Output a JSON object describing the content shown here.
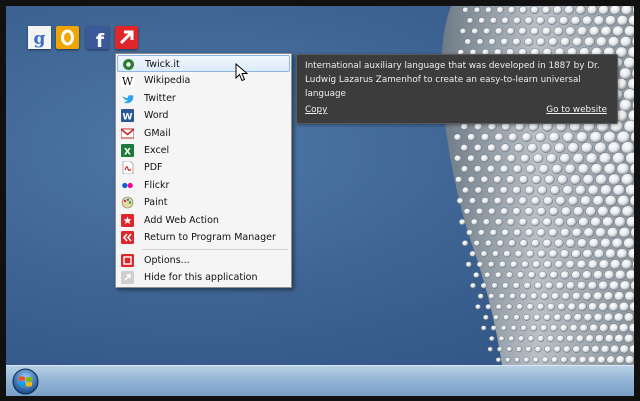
{
  "top_icons": [
    {
      "icon": "google-icon",
      "glyph": "g",
      "color": "#3a6fc9"
    },
    {
      "icon": "orange-o-icon",
      "glyph": "O",
      "color": "#f0a500"
    },
    {
      "icon": "facebook-icon",
      "glyph": "f",
      "color": "#3b5998"
    },
    {
      "icon": "twickit-arrow-icon",
      "glyph": "↗",
      "color": "#e0262a"
    }
  ],
  "menu": {
    "items": [
      {
        "label": "Twick.it",
        "icon": "twickit-icon",
        "selected": true
      },
      {
        "label": "Wikipedia",
        "icon": "wikipedia-icon"
      },
      {
        "label": "Twitter",
        "icon": "twitter-icon"
      },
      {
        "label": "Word",
        "icon": "word-icon"
      },
      {
        "label": "GMail",
        "icon": "gmail-icon"
      },
      {
        "label": "Excel",
        "icon": "excel-icon"
      },
      {
        "label": "PDF",
        "icon": "pdf-icon"
      },
      {
        "label": "Flickr",
        "icon": "flickr-icon"
      },
      {
        "label": "Paint",
        "icon": "paint-icon"
      },
      {
        "label": "Add Web Action",
        "icon": "add-web-action-icon"
      },
      {
        "label": "Return to Program Manager",
        "icon": "return-icon"
      }
    ],
    "footer_items": [
      {
        "label": "Options...",
        "icon": "options-icon"
      },
      {
        "label": "Hide for this application",
        "icon": "hide-icon"
      }
    ]
  },
  "tooltip": {
    "text": "International auxiliary language that was developed in 1887 by Dr. Ludwig Lazarus Zamenhof to create an easy-to-learn universal language",
    "copy_label": "Copy",
    "website_label": "Go to website"
  },
  "colors": {
    "accent": "#e0262a",
    "tooltip_bg": "#3c3c3c"
  }
}
